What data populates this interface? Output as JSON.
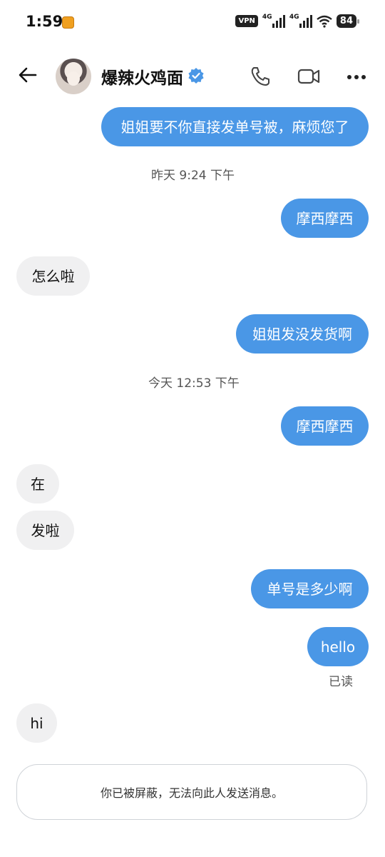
{
  "status_bar": {
    "time": "1:59",
    "vpn": "VPN",
    "network_1": "4G",
    "network_2": "4G",
    "battery": "84"
  },
  "header": {
    "contact_name": "爆辣火鸡面",
    "icons": [
      "back-arrow-icon",
      "avatar",
      "verified-badge-icon",
      "phone-icon",
      "video-call-icon",
      "more-icon"
    ]
  },
  "messages": [
    {
      "dir": "out",
      "text": "姐姐要不你直接发单号被，麻烦您了"
    },
    {
      "type": "time",
      "text": "昨天 9:24 下午"
    },
    {
      "dir": "out",
      "text": "摩西摩西"
    },
    {
      "dir": "in",
      "text": "怎么啦"
    },
    {
      "dir": "out",
      "text": "姐姐发没发货啊"
    },
    {
      "type": "time",
      "text": "今天 12:53 下午"
    },
    {
      "dir": "out",
      "text": "摩西摩西"
    },
    {
      "dir": "in",
      "text": "在"
    },
    {
      "dir": "in",
      "text": "发啦"
    },
    {
      "dir": "out",
      "text": "单号是多少啊"
    },
    {
      "dir": "out",
      "text": "hello"
    },
    {
      "dir": "in",
      "text": "hi"
    }
  ],
  "read_receipt": "已读",
  "blocked_notice": "你已被屏蔽，无法向此人发送消息。",
  "colors": {
    "outgoing_bubble": "#4a97e6",
    "incoming_bubble": "#f0f0f1",
    "verified_badge": "#4a97e6"
  }
}
